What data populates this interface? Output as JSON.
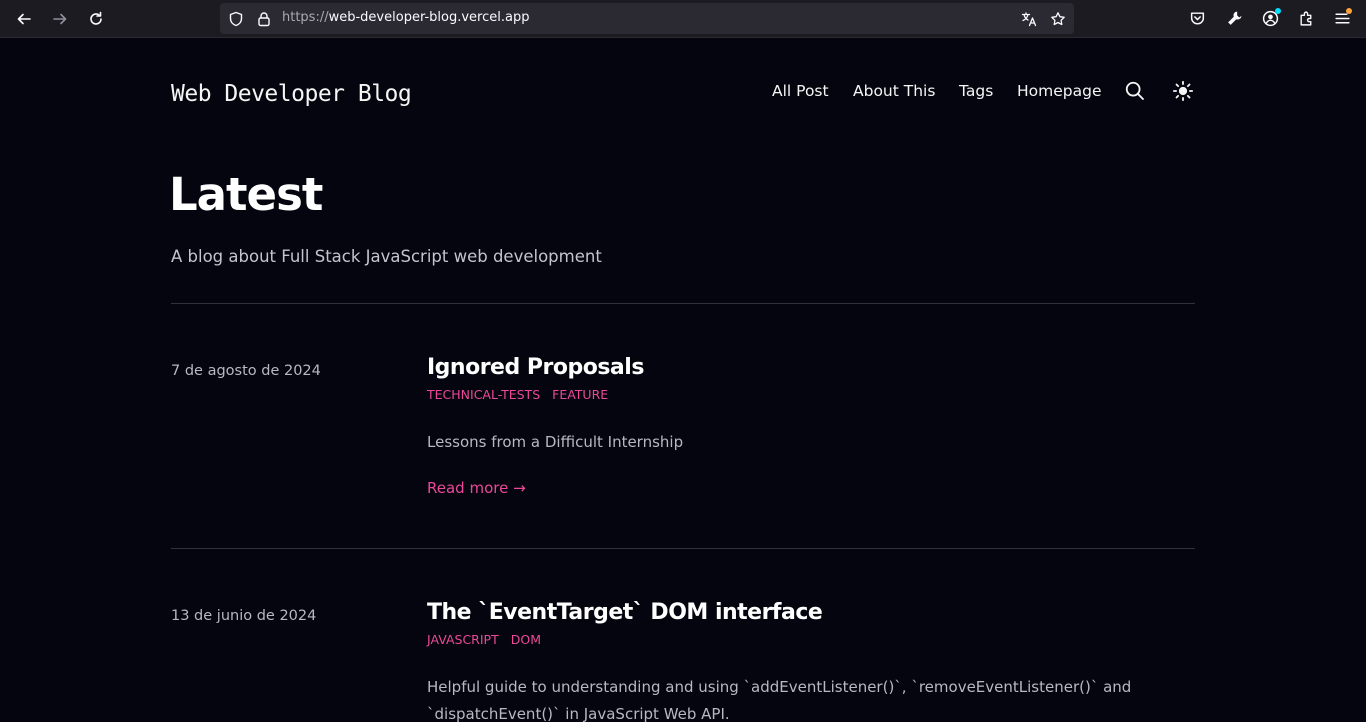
{
  "browser": {
    "url_protocol": "https://",
    "url_host": "web-developer-blog.vercel.app",
    "icons": [
      "back-icon",
      "forward-icon",
      "reload-icon",
      "shield-icon",
      "lock-icon",
      "translate-icon",
      "bookmark-star-icon",
      "pocket-icon",
      "wrench-icon",
      "account-icon",
      "extensions-icon",
      "menu-icon"
    ]
  },
  "site": {
    "title": "Web Developer Blog",
    "nav": [
      "All Post",
      "About This",
      "Tags",
      "Homepage"
    ],
    "icons": [
      "search-icon",
      "theme-toggle-sun-icon"
    ]
  },
  "hero": {
    "heading": "Latest",
    "tagline": "A blog about Full Stack JavaScript web development"
  },
  "posts": [
    {
      "date": "7 de agosto de 2024",
      "title": "Ignored Proposals",
      "tags": [
        "TECHNICAL-TESTS",
        "FEATURE"
      ],
      "summary": "Lessons from a Difficult Internship",
      "read_more": "Read more →"
    },
    {
      "date": "13 de junio de 2024",
      "title": "The `EventTarget` DOM interface",
      "tags": [
        "JAVASCRIPT",
        "DOM"
      ],
      "summary": "Helpful guide to understanding and using `addEventListener()`, `removeEventListener()` and `dispatchEvent()` in JavaScript Web API."
    }
  ],
  "colors": {
    "background": "#04050e",
    "accent": "#ec4899",
    "chrome": "#1c1b22"
  }
}
